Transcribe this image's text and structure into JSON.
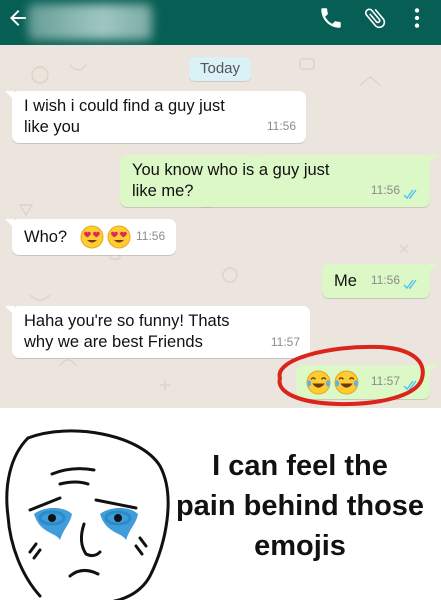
{
  "header": {
    "contact_name": "",
    "background": "#075e54",
    "icons": [
      "back-arrow-icon",
      "phone-icon",
      "attachment-icon",
      "more-icon"
    ]
  },
  "chat": {
    "date_label": "Today",
    "messages": [
      {
        "direction": "incoming",
        "text_lines": [
          "I wish i could find a guy just",
          "like you"
        ],
        "time": "11:56"
      },
      {
        "direction": "outgoing",
        "text_lines": [
          "You know who is a guy just",
          "like me?"
        ],
        "time": "11:56",
        "status": "read"
      },
      {
        "direction": "incoming",
        "text": "Who?",
        "emojis": [
          "heart-eyes-emoji",
          "heart-eyes-emoji"
        ],
        "time": "11:56"
      },
      {
        "direction": "outgoing",
        "text": "Me",
        "time": "11:56",
        "status": "read"
      },
      {
        "direction": "incoming",
        "text_lines": [
          "Haha you're so funny! Thats",
          "why we are best Friends"
        ],
        "time": "11:57"
      },
      {
        "direction": "outgoing",
        "emojis": [
          "tears-of-joy-emoji",
          "tears-of-joy-emoji"
        ],
        "time": "11:57",
        "status": "read",
        "highlighted": true
      }
    ],
    "colors": {
      "incoming": "#ffffff",
      "outgoing": "#dcf8c6",
      "background": "#ece5dd",
      "highlight_circle": "#d9251c",
      "read_ticks": "#4fc3f7"
    }
  },
  "meme": {
    "caption_lines": [
      "I can feel the",
      "pain behind those",
      "emojis"
    ],
    "face": "crying-rage-face"
  }
}
